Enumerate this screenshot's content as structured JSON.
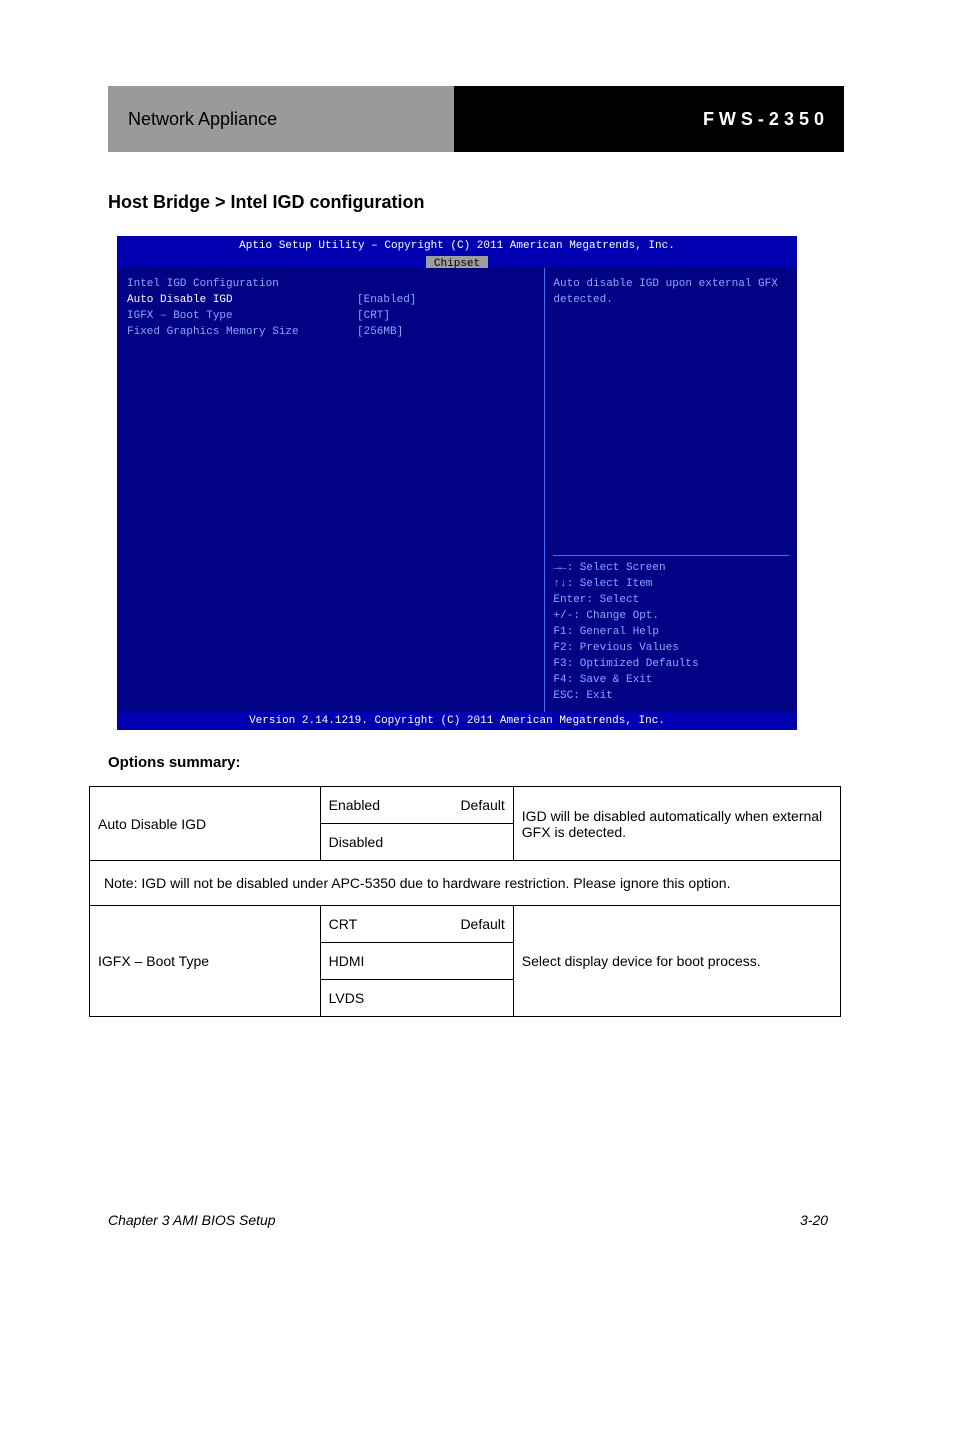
{
  "header": {
    "gray": "Network Appliance",
    "black": "F W S - 2 3 5 0"
  },
  "host_heading": "Host Bridge > Intel IGD configuration",
  "bios": {
    "title": "Aptio Setup Utility – Copyright (C) 2011 American Megatrends, Inc.",
    "tab": "Chipset",
    "left": {
      "heading": "Intel IGD Configuration",
      "rows": [
        {
          "label": "Auto Disable IGD",
          "value": "[Enabled]",
          "selected": true
        },
        {
          "label": "IGFX – Boot Type",
          "value": "[CRT]",
          "selected": false
        },
        {
          "label": "Fixed Graphics Memory Size",
          "value": "[256MB]",
          "selected": false
        }
      ]
    },
    "right": {
      "help": "Auto disable IGD upon external GFX detected.",
      "nav": [
        "→←: Select Screen",
        "↑↓: Select Item",
        "Enter: Select",
        "+/-: Change Opt.",
        "F1: General Help",
        "F2: Previous Values",
        "F3: Optimized Defaults",
        "F4: Save & Exit",
        "ESC: Exit"
      ]
    },
    "footer": "Version 2.14.1219. Copyright (C) 2011 American Megatrends, Inc."
  },
  "options_heading": "Options summary:",
  "table": {
    "r1": {
      "c1": "Auto Disable IGD",
      "c2a": "Enabled",
      "c2a_right": "Default",
      "c2b": "Disabled",
      "c3": "IGD will be disabled automatically when external GFX is detected."
    },
    "note": "Note: IGD will not be disabled under APC-5350 due to hardware restriction. Please ignore this option.",
    "r3": {
      "c1": "IGFX – Boot Type",
      "c2a": "CRT",
      "c2a_right": "Default",
      "c2b": "HDMI",
      "c2c": "LVDS",
      "c3": "Select display device for boot process."
    }
  },
  "page_footer": {
    "left": "Chapter 3 AMI BIOS Setup",
    "right": "3-20"
  }
}
